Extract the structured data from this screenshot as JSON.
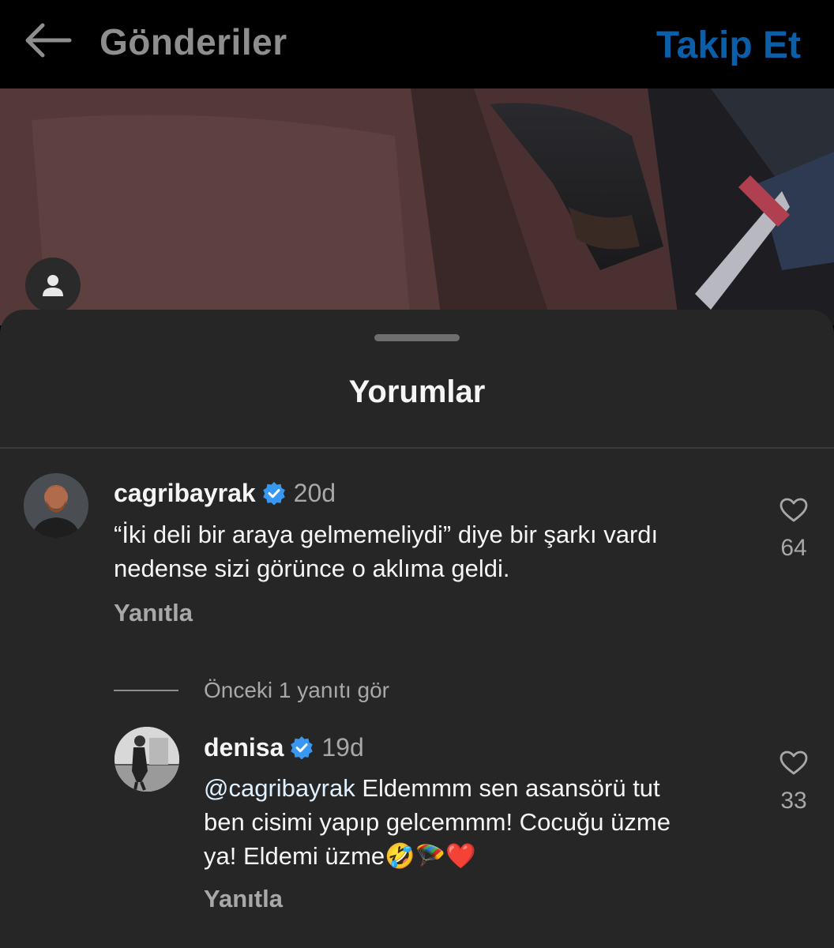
{
  "header": {
    "title": "Gönderiler",
    "follow_label": "Takip Et"
  },
  "sheet": {
    "title": "Yorumlar"
  },
  "comments": [
    {
      "username": "cagribayrak",
      "verified": true,
      "age": "20d",
      "text_line1": "“İki deli bir araya gelmemeliydi” diye bir şarkı vardı",
      "text_line2": "nedense sizi görünce o aklıma geldi.",
      "reply_label": "Yanıtla",
      "likes": "64"
    }
  ],
  "thread": {
    "view_replies": "Önceki 1 yanıtı gör"
  },
  "replies": [
    {
      "username": "denisa",
      "verified": true,
      "age": "19d",
      "mention": "@cagribayrak",
      "text_line1_rest": " Eldemmm sen asansörü tut",
      "text_line2": "ben cisimi yapıp gelcemmm! Cocuğu üzme",
      "text_line3": "ya! Eldemi üzme",
      "emojis": "🤣🪂❤️",
      "reply_label": "Yanıtla",
      "likes": "33"
    }
  ],
  "colors": {
    "accent": "#0a5fa8",
    "sheet_bg": "#262626",
    "verified": "#3897f0"
  }
}
